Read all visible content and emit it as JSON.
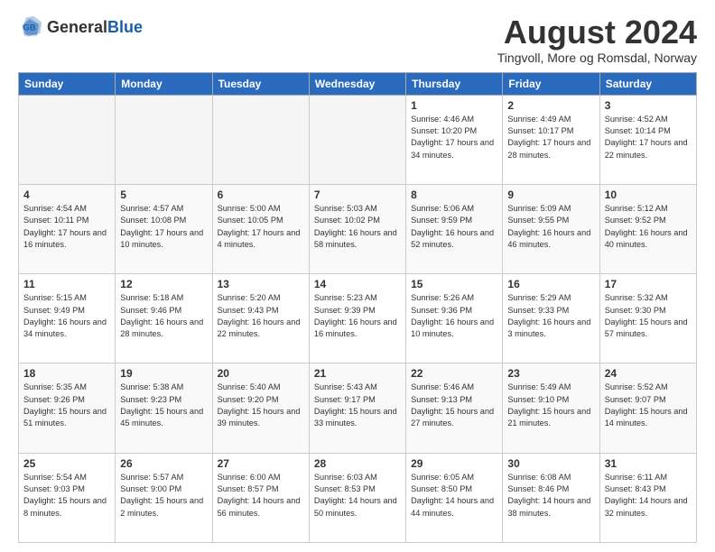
{
  "header": {
    "logo_general": "General",
    "logo_blue": "Blue",
    "month_title": "August 2024",
    "location": "Tingvoll, More og Romsdal, Norway"
  },
  "days_of_week": [
    "Sunday",
    "Monday",
    "Tuesday",
    "Wednesday",
    "Thursday",
    "Friday",
    "Saturday"
  ],
  "weeks": [
    [
      {
        "day": "",
        "empty": true
      },
      {
        "day": "",
        "empty": true
      },
      {
        "day": "",
        "empty": true
      },
      {
        "day": "",
        "empty": true
      },
      {
        "day": "1",
        "sunrise": "4:46 AM",
        "sunset": "10:20 PM",
        "daylight": "17 hours and 34 minutes."
      },
      {
        "day": "2",
        "sunrise": "4:49 AM",
        "sunset": "10:17 PM",
        "daylight": "17 hours and 28 minutes."
      },
      {
        "day": "3",
        "sunrise": "4:52 AM",
        "sunset": "10:14 PM",
        "daylight": "17 hours and 22 minutes."
      }
    ],
    [
      {
        "day": "4",
        "sunrise": "4:54 AM",
        "sunset": "10:11 PM",
        "daylight": "17 hours and 16 minutes."
      },
      {
        "day": "5",
        "sunrise": "4:57 AM",
        "sunset": "10:08 PM",
        "daylight": "17 hours and 10 minutes."
      },
      {
        "day": "6",
        "sunrise": "5:00 AM",
        "sunset": "10:05 PM",
        "daylight": "17 hours and 4 minutes."
      },
      {
        "day": "7",
        "sunrise": "5:03 AM",
        "sunset": "10:02 PM",
        "daylight": "16 hours and 58 minutes."
      },
      {
        "day": "8",
        "sunrise": "5:06 AM",
        "sunset": "9:59 PM",
        "daylight": "16 hours and 52 minutes."
      },
      {
        "day": "9",
        "sunrise": "5:09 AM",
        "sunset": "9:55 PM",
        "daylight": "16 hours and 46 minutes."
      },
      {
        "day": "10",
        "sunrise": "5:12 AM",
        "sunset": "9:52 PM",
        "daylight": "16 hours and 40 minutes."
      }
    ],
    [
      {
        "day": "11",
        "sunrise": "5:15 AM",
        "sunset": "9:49 PM",
        "daylight": "16 hours and 34 minutes."
      },
      {
        "day": "12",
        "sunrise": "5:18 AM",
        "sunset": "9:46 PM",
        "daylight": "16 hours and 28 minutes."
      },
      {
        "day": "13",
        "sunrise": "5:20 AM",
        "sunset": "9:43 PM",
        "daylight": "16 hours and 22 minutes."
      },
      {
        "day": "14",
        "sunrise": "5:23 AM",
        "sunset": "9:39 PM",
        "daylight": "16 hours and 16 minutes."
      },
      {
        "day": "15",
        "sunrise": "5:26 AM",
        "sunset": "9:36 PM",
        "daylight": "16 hours and 10 minutes."
      },
      {
        "day": "16",
        "sunrise": "5:29 AM",
        "sunset": "9:33 PM",
        "daylight": "16 hours and 3 minutes."
      },
      {
        "day": "17",
        "sunrise": "5:32 AM",
        "sunset": "9:30 PM",
        "daylight": "15 hours and 57 minutes."
      }
    ],
    [
      {
        "day": "18",
        "sunrise": "5:35 AM",
        "sunset": "9:26 PM",
        "daylight": "15 hours and 51 minutes."
      },
      {
        "day": "19",
        "sunrise": "5:38 AM",
        "sunset": "9:23 PM",
        "daylight": "15 hours and 45 minutes."
      },
      {
        "day": "20",
        "sunrise": "5:40 AM",
        "sunset": "9:20 PM",
        "daylight": "15 hours and 39 minutes."
      },
      {
        "day": "21",
        "sunrise": "5:43 AM",
        "sunset": "9:17 PM",
        "daylight": "15 hours and 33 minutes."
      },
      {
        "day": "22",
        "sunrise": "5:46 AM",
        "sunset": "9:13 PM",
        "daylight": "15 hours and 27 minutes."
      },
      {
        "day": "23",
        "sunrise": "5:49 AM",
        "sunset": "9:10 PM",
        "daylight": "15 hours and 21 minutes."
      },
      {
        "day": "24",
        "sunrise": "5:52 AM",
        "sunset": "9:07 PM",
        "daylight": "15 hours and 14 minutes."
      }
    ],
    [
      {
        "day": "25",
        "sunrise": "5:54 AM",
        "sunset": "9:03 PM",
        "daylight": "15 hours and 8 minutes."
      },
      {
        "day": "26",
        "sunrise": "5:57 AM",
        "sunset": "9:00 PM",
        "daylight": "15 hours and 2 minutes."
      },
      {
        "day": "27",
        "sunrise": "6:00 AM",
        "sunset": "8:57 PM",
        "daylight": "14 hours and 56 minutes."
      },
      {
        "day": "28",
        "sunrise": "6:03 AM",
        "sunset": "8:53 PM",
        "daylight": "14 hours and 50 minutes."
      },
      {
        "day": "29",
        "sunrise": "6:05 AM",
        "sunset": "8:50 PM",
        "daylight": "14 hours and 44 minutes."
      },
      {
        "day": "30",
        "sunrise": "6:08 AM",
        "sunset": "8:46 PM",
        "daylight": "14 hours and 38 minutes."
      },
      {
        "day": "31",
        "sunrise": "6:11 AM",
        "sunset": "8:43 PM",
        "daylight": "14 hours and 32 minutes."
      }
    ]
  ],
  "labels": {
    "sunrise_label": "Sunrise:",
    "sunset_label": "Sunset:",
    "daylight_label": "Daylight:"
  }
}
